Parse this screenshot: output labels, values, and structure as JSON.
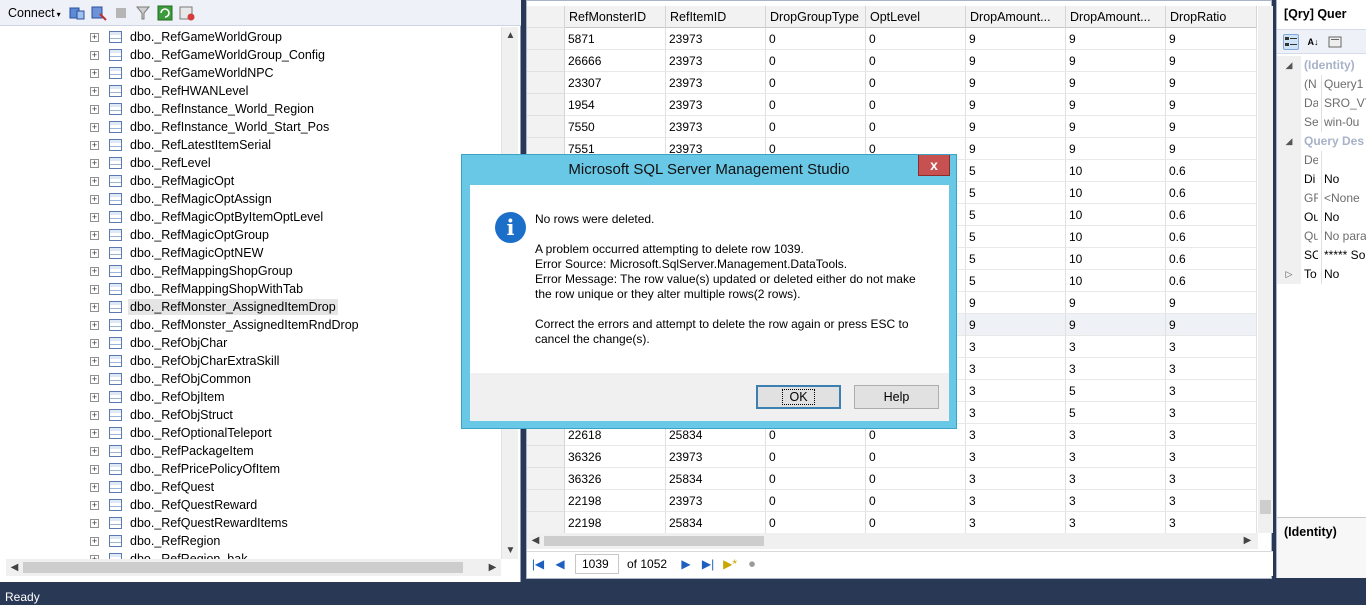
{
  "object_explorer": {
    "connect_label": "Connect",
    "connect_caret": "▾",
    "expander_glyph": "+",
    "selected_index": 15,
    "tables": [
      "dbo._RefGameWorldGroup",
      "dbo._RefGameWorldGroup_Config",
      "dbo._RefGameWorldNPC",
      "dbo._RefHWANLevel",
      "dbo._RefInstance_World_Region",
      "dbo._RefInstance_World_Start_Pos",
      "dbo._RefLatestItemSerial",
      "dbo._RefLevel",
      "dbo._RefMagicOpt",
      "dbo._RefMagicOptAssign",
      "dbo._RefMagicOptByItemOptLevel",
      "dbo._RefMagicOptGroup",
      "dbo._RefMagicOptNEW",
      "dbo._RefMappingShopGroup",
      "dbo._RefMappingShopWithTab",
      "dbo._RefMonster_AssignedItemDrop",
      "dbo._RefMonster_AssignedItemRndDrop",
      "dbo._RefObjChar",
      "dbo._RefObjCharExtraSkill",
      "dbo._RefObjCommon",
      "dbo._RefObjItem",
      "dbo._RefObjStruct",
      "dbo._RefOptionalTeleport",
      "dbo._RefPackageItem",
      "dbo._RefPricePolicyOfItem",
      "dbo._RefQuest",
      "dbo._RefQuestReward",
      "dbo._RefQuestRewardItems",
      "dbo._RefRegion",
      "dbo._RefRegion_bak"
    ]
  },
  "grid": {
    "columns": [
      "RefMonsterID",
      "RefItemID",
      "DropGroupType",
      "OptLevel",
      "DropAmount...",
      "DropAmount...",
      "DropRatio"
    ],
    "highlighted_row": 13,
    "rows": [
      [
        "5871",
        "23973",
        "0",
        "0",
        "9",
        "9",
        "9"
      ],
      [
        "26666",
        "23973",
        "0",
        "0",
        "9",
        "9",
        "9"
      ],
      [
        "23307",
        "23973",
        "0",
        "0",
        "9",
        "9",
        "9"
      ],
      [
        "1954",
        "23973",
        "0",
        "0",
        "9",
        "9",
        "9"
      ],
      [
        "7550",
        "23973",
        "0",
        "0",
        "9",
        "9",
        "9"
      ],
      [
        "7551",
        "23973",
        "0",
        "0",
        "9",
        "9",
        "9"
      ],
      [
        "",
        "",
        "",
        "",
        "5",
        "10",
        "0.6"
      ],
      [
        "",
        "",
        "",
        "",
        "5",
        "10",
        "0.6"
      ],
      [
        "",
        "",
        "",
        "",
        "5",
        "10",
        "0.6"
      ],
      [
        "",
        "",
        "",
        "",
        "5",
        "10",
        "0.6"
      ],
      [
        "",
        "",
        "",
        "",
        "5",
        "10",
        "0.6"
      ],
      [
        "",
        "",
        "",
        "",
        "5",
        "10",
        "0.6"
      ],
      [
        "",
        "",
        "",
        "",
        "9",
        "9",
        "9"
      ],
      [
        "",
        "",
        "",
        "",
        "9",
        "9",
        "9"
      ],
      [
        "",
        "",
        "",
        "",
        "3",
        "3",
        "3"
      ],
      [
        "",
        "",
        "",
        "",
        "3",
        "3",
        "3"
      ],
      [
        "",
        "",
        "",
        "",
        "3",
        "5",
        "3"
      ],
      [
        "",
        "",
        "",
        "",
        "3",
        "5",
        "3"
      ],
      [
        "22618",
        "25834",
        "0",
        "0",
        "3",
        "3",
        "3"
      ],
      [
        "36326",
        "23973",
        "0",
        "0",
        "3",
        "3",
        "3"
      ],
      [
        "36326",
        "25834",
        "0",
        "0",
        "3",
        "3",
        "3"
      ],
      [
        "22198",
        "23973",
        "0",
        "0",
        "3",
        "3",
        "3"
      ],
      [
        "22198",
        "25834",
        "0",
        "0",
        "3",
        "3",
        "3"
      ]
    ],
    "navigator": {
      "current_record": "1039",
      "of_label": "of 1052"
    }
  },
  "properties": {
    "title": "[Qry] Quer",
    "rows": [
      {
        "kind": "cat",
        "label": "(Identity)",
        "gutter": "◢"
      },
      {
        "kind": "prop",
        "name": "(N",
        "value": "Query1"
      },
      {
        "kind": "prop",
        "name": "Da",
        "value": "SRO_VT"
      },
      {
        "kind": "prop",
        "name": "Se",
        "value": "win-0u"
      },
      {
        "kind": "cat",
        "label": "Query Des",
        "gutter": "◢"
      },
      {
        "kind": "prop",
        "name": "De",
        "value": ""
      },
      {
        "kind": "prop",
        "name": "Di",
        "value": "No",
        "active": true
      },
      {
        "kind": "prop",
        "name": "GF",
        "value": "<None"
      },
      {
        "kind": "prop",
        "name": "Ou",
        "value": "No",
        "active": true
      },
      {
        "kind": "prop",
        "name": "Qu",
        "value": "No para"
      },
      {
        "kind": "prop",
        "name": "SC",
        "value": "***** So",
        "active": true
      },
      {
        "kind": "prop",
        "name": "To",
        "value": "No",
        "active": true,
        "gutter": "▷"
      }
    ],
    "description_title": "(Identity)"
  },
  "status_bar": {
    "text": "Ready"
  },
  "dialog": {
    "title": "Microsoft SQL Server Management Studio",
    "close_glyph": "x",
    "icon_glyph": "i",
    "line1": "No rows were deleted.",
    "line2": "A problem occurred attempting to delete row 1039.",
    "line3": "Error Source: Microsoft.SqlServer.Management.DataTools.",
    "line4": "Error Message: The row value(s) updated or deleted either do not make",
    "line5": "the row unique or they alter multiple rows(2 rows).",
    "line6": "Correct the errors and attempt to delete the row again or press ESC to",
    "line7": "cancel the change(s).",
    "ok_label": "OK",
    "help_label": "Help"
  },
  "colors": {
    "app_background": "#293955",
    "dialog_frame": "#69c8e5",
    "close_button": "#c75050",
    "info_icon": "#1c6fc9",
    "nav_arrows": "#1f5fbf"
  }
}
